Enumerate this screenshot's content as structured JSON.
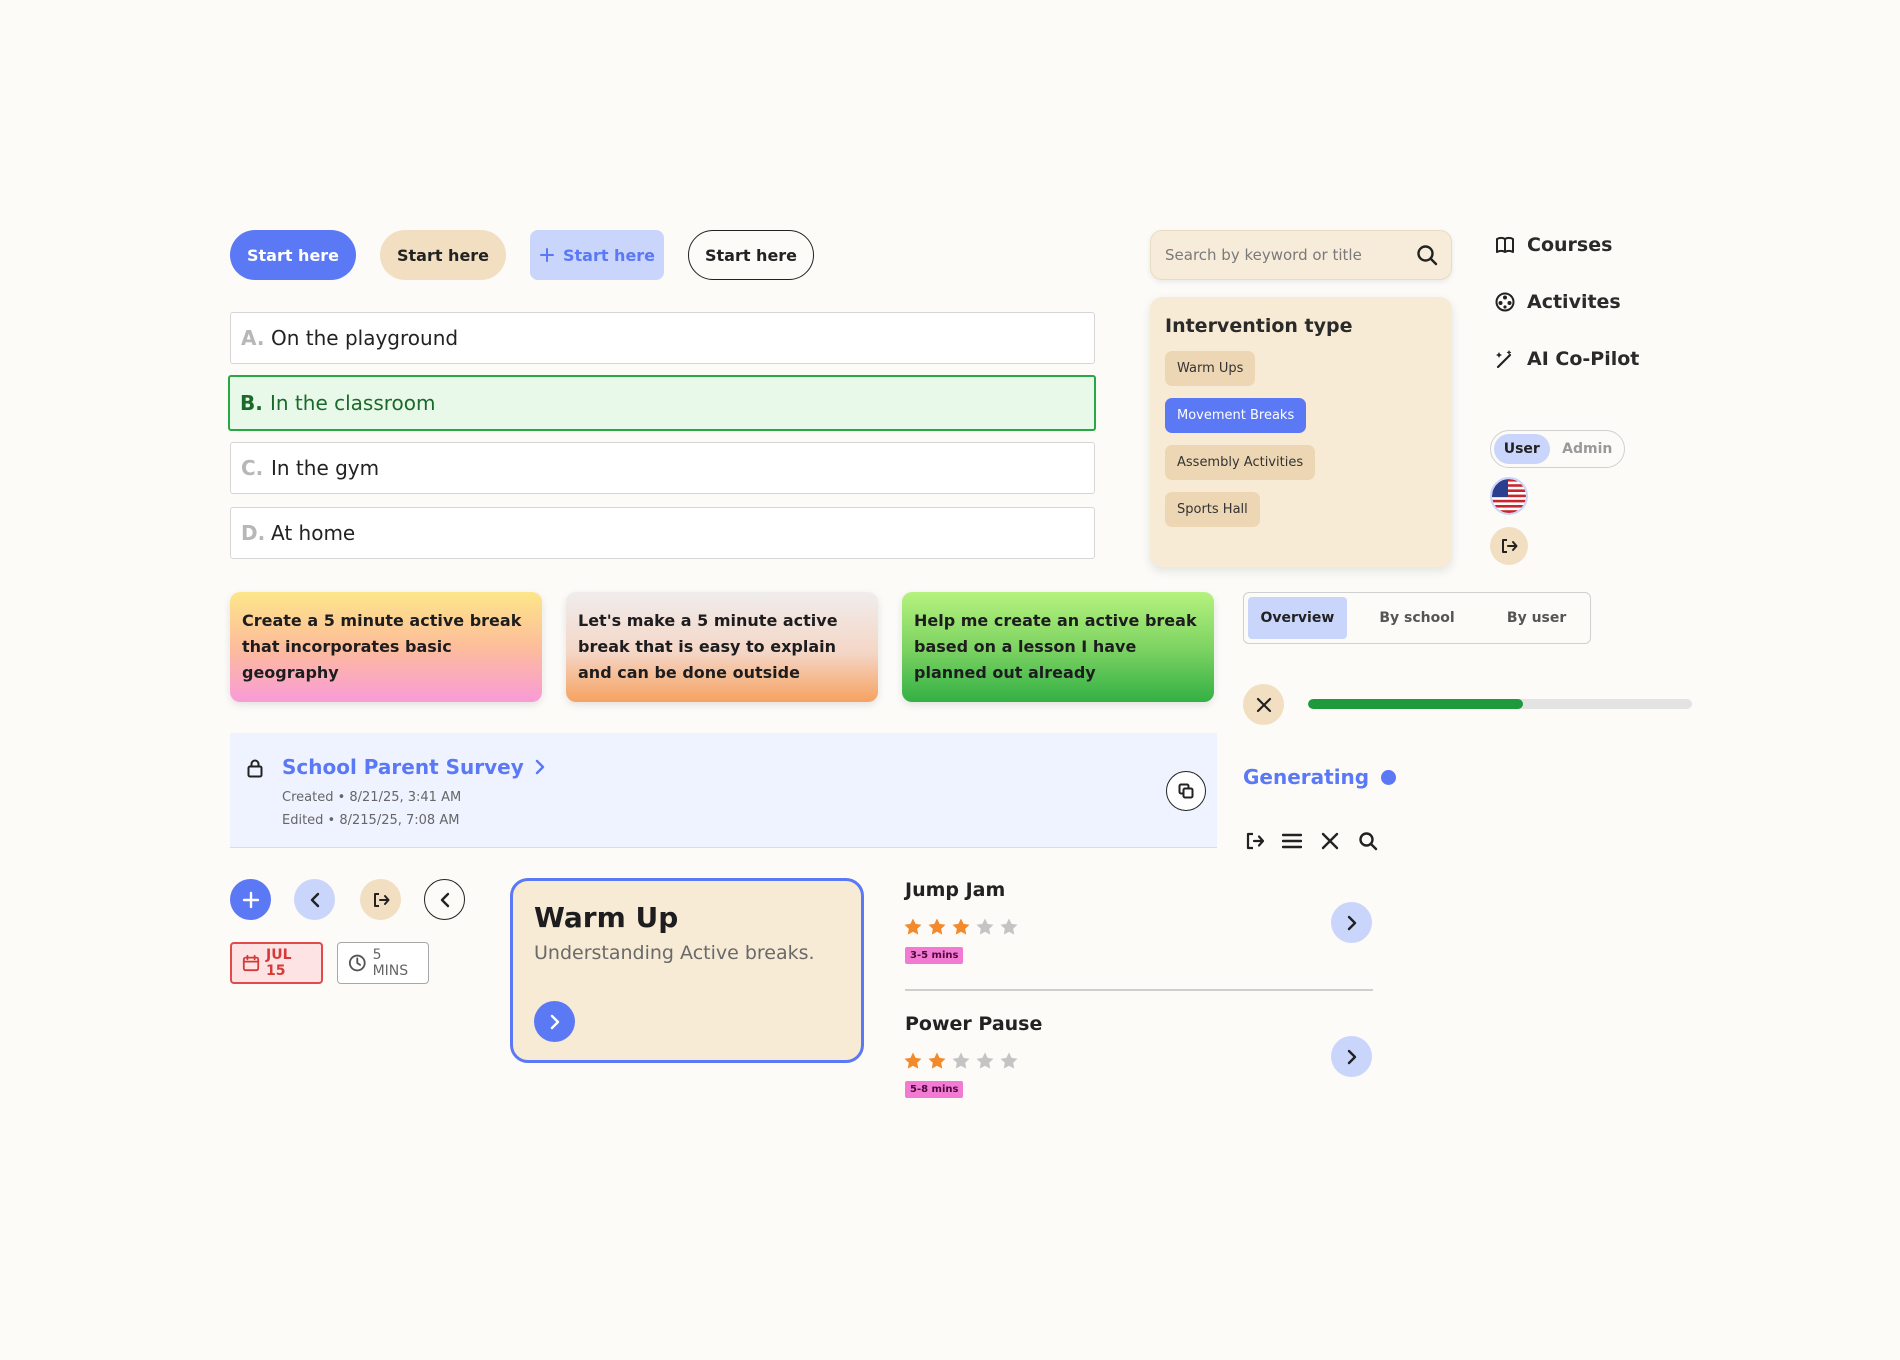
{
  "buttons": {
    "primary": "Start here",
    "secondary": "Start here",
    "tertiary": "Start here",
    "outline": "Start here"
  },
  "quiz": {
    "options": [
      {
        "letter": "A.",
        "text": "On the playground",
        "selected": false
      },
      {
        "letter": "B.",
        "text": "In the classroom",
        "selected": true
      },
      {
        "letter": "C.",
        "text": "In the gym",
        "selected": false
      },
      {
        "letter": "D.",
        "text": "At home",
        "selected": false
      }
    ]
  },
  "search": {
    "placeholder": "Search by keyword or title",
    "icon": "search-icon"
  },
  "filter": {
    "title": "Intervention type",
    "chips": [
      {
        "label": "Warm Ups",
        "active": false
      },
      {
        "label": "Movement Breaks",
        "active": true
      },
      {
        "label": "Assembly Activities",
        "active": false
      },
      {
        "label": "Sports Hall",
        "active": false
      }
    ]
  },
  "nav": {
    "items": [
      {
        "label": "Courses",
        "icon": "book-icon"
      },
      {
        "label": "Activites",
        "icon": "ball-icon"
      },
      {
        "label": "AI Co-Pilot",
        "icon": "magic-wand-icon"
      }
    ]
  },
  "role_toggle": {
    "user": "User",
    "admin": "Admin",
    "selected": "User"
  },
  "prompts": {
    "cards": [
      "Create a 5 minute active break that incorporates basic geography",
      "Let's make a 5 minute active break that is easy to explain and can be done outside",
      "Help me create an active break based on a lesson I have planned out already"
    ]
  },
  "tabs": {
    "items": [
      "Overview",
      "By school",
      "By user"
    ],
    "active": "Overview"
  },
  "progress": {
    "value": 0.56,
    "color": "#1e9a3c"
  },
  "survey": {
    "title": "School Parent Survey",
    "created": "Created • 8/21/25, 3:41 AM",
    "edited": "Edited • 8/215/25, 7:08 AM"
  },
  "status": {
    "label": "Generating"
  },
  "badges": {
    "date": "JUL 15",
    "duration": "5 MINS"
  },
  "warmup": {
    "title": "Warm Up",
    "subtitle": "Understanding Active breaks."
  },
  "activities": [
    {
      "title": "Jump Jam",
      "rating": 3,
      "max": 5,
      "tag": "3-5 mins"
    },
    {
      "title": "Power Pause",
      "rating": 2,
      "max": 5,
      "tag": "5-8 mins"
    }
  ],
  "colors": {
    "accent": "#5b78f5",
    "beige": "#f2dfc2",
    "success": "#27a844",
    "star": "#f28a2c"
  }
}
